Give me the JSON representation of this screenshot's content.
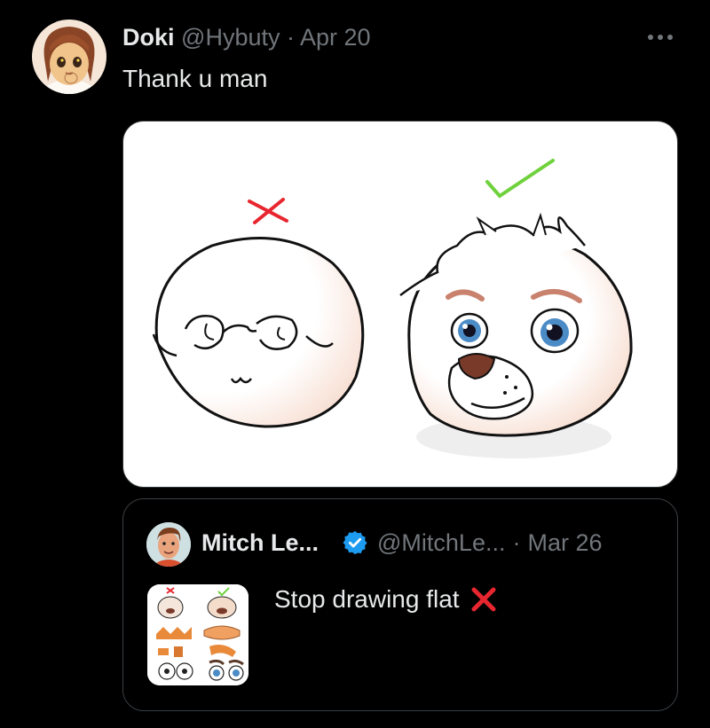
{
  "tweet": {
    "display_name": "Doki",
    "handle": "@Hybuty",
    "separator": "·",
    "date": "Apr 20",
    "text": "Thank u man",
    "more_icon": "more-horizontal-icon"
  },
  "quoted_tweet": {
    "display_name": "Mitch Le...",
    "handle": "@MitchLe...",
    "separator": "·",
    "date": "Mar 26",
    "text": "Stop drawing flat",
    "verified_icon": "verified-badge-icon",
    "emoji": "cross-mark-icon"
  },
  "colors": {
    "background": "#000000",
    "text_primary": "#e7e9ea",
    "text_secondary": "#71767b",
    "verified_blue": "#1d9bf0",
    "cross_red": "#e8262f",
    "check_green": "#6fd23c"
  }
}
